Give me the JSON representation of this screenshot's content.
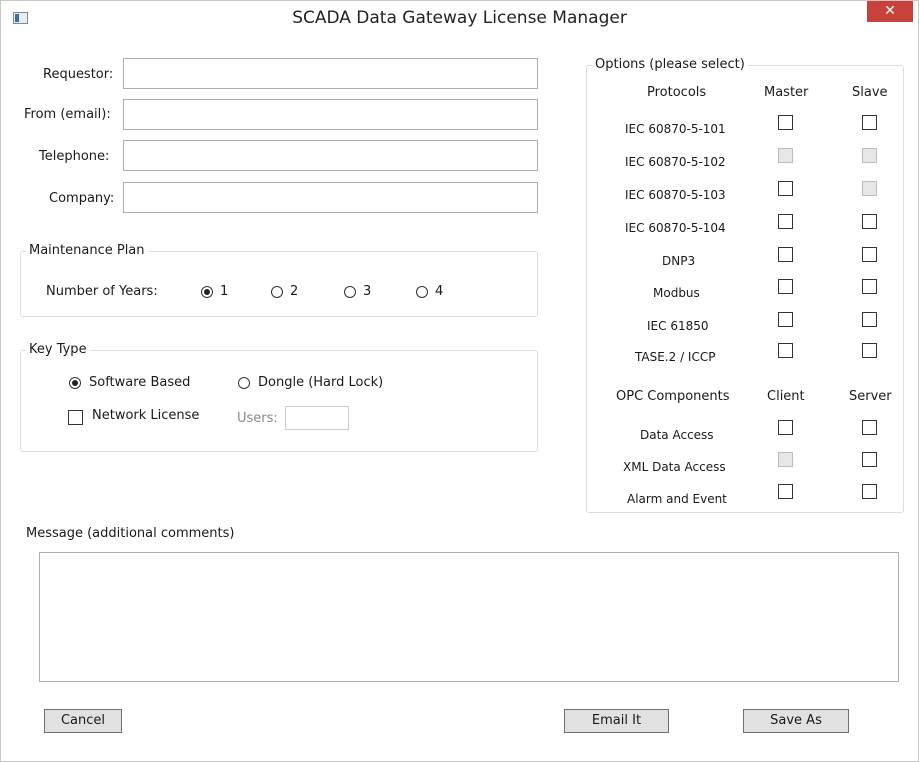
{
  "window": {
    "title": "SCADA Data Gateway License Manager",
    "close_glyph": "✕"
  },
  "form": {
    "requestor_label": "Requestor:",
    "from_label": "From (email):",
    "telephone_label": "Telephone:",
    "company_label": "Company:",
    "requestor_value": "",
    "from_value": "",
    "telephone_value": "",
    "company_value": ""
  },
  "maintenance": {
    "legend": "Maintenance Plan",
    "years_label": "Number of Years:",
    "options": [
      "1",
      "2",
      "3",
      "4"
    ],
    "selected": "1"
  },
  "key_type": {
    "legend": "Key Type",
    "software": "Software Based",
    "dongle": "Dongle (Hard Lock)",
    "selected": "Software Based",
    "network_license": "Network License",
    "network_checked": false,
    "users_label": "Users:",
    "users_value": ""
  },
  "options": {
    "legend": "Options (please select)",
    "protocols_header": "Protocols",
    "master_header": "Master",
    "slave_header": "Slave",
    "protocols": [
      {
        "name": "IEC 60870-5-101",
        "master": "enabled",
        "slave": "enabled"
      },
      {
        "name": "IEC 60870-5-102",
        "master": "disabled",
        "slave": "disabled"
      },
      {
        "name": "IEC 60870-5-103",
        "master": "enabled",
        "slave": "disabled"
      },
      {
        "name": "IEC 60870-5-104",
        "master": "enabled",
        "slave": "enabled"
      },
      {
        "name": "DNP3",
        "master": "enabled",
        "slave": "enabled"
      },
      {
        "name": "Modbus",
        "master": "enabled",
        "slave": "enabled"
      },
      {
        "name": "IEC 61850",
        "master": "enabled",
        "slave": "enabled"
      },
      {
        "name": "TASE.2 / ICCP",
        "master": "enabled",
        "slave": "enabled"
      }
    ],
    "opc_header": "OPC Components",
    "client_header": "Client",
    "server_header": "Server",
    "opc": [
      {
        "name": "Data Access",
        "client": "enabled",
        "server": "enabled"
      },
      {
        "name": "XML Data Access",
        "client": "disabled",
        "server": "enabled"
      },
      {
        "name": "Alarm and Event",
        "client": "enabled",
        "server": "enabled"
      }
    ]
  },
  "message": {
    "label": "Message (additional comments)",
    "value": ""
  },
  "buttons": {
    "cancel": "Cancel",
    "email": "Email It",
    "save_as": "Save As"
  },
  "icons": {
    "app": "app-window-icon",
    "close": "close-icon"
  }
}
